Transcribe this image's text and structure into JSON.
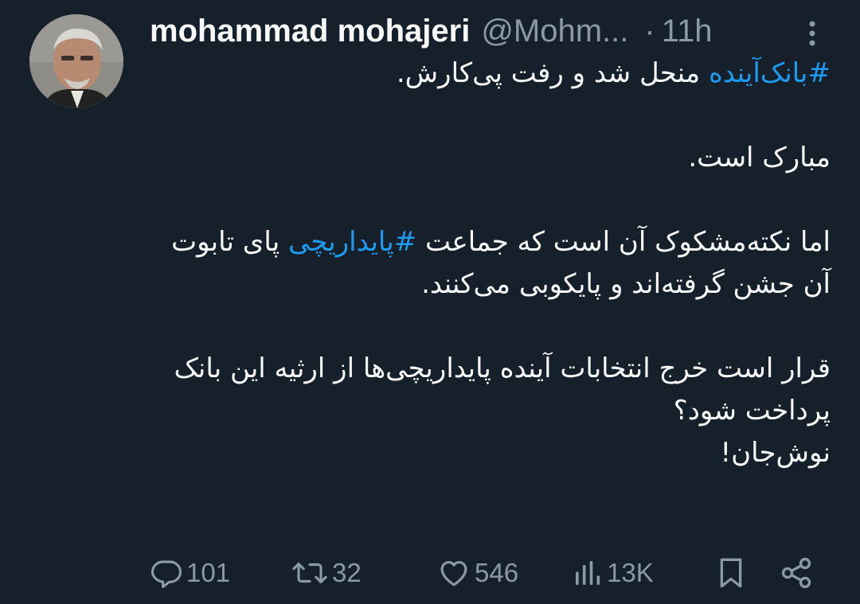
{
  "author": {
    "name": "mohammad mohajeri",
    "handle": "@Mohm...",
    "separator": "·",
    "time": "11h"
  },
  "tweet": {
    "line1_hashtag": "#بانک‌آینده",
    "line1_rest": " منحل شد و رفت پی‌کارش.",
    "line2": "مبارک است.",
    "line3_start": "اما نکته‌مشکوک آن است که جماعت ",
    "line3_hashtag": "#پایداریچی",
    "line3_end": " پای تابوت آن جشن گرفته‌اند و پایکوبی می‌کنند.",
    "line4": "قرار است خرج انتخابات آینده پایداریچی‌ها از ارثیه این بانک پرداخت شود؟",
    "line5": "نوش‌جان!"
  },
  "actions": {
    "replies": "101",
    "retweets": "32",
    "likes": "546",
    "views": "13K"
  },
  "icons": [
    "more-icon",
    "reply-icon",
    "retweet-icon",
    "like-icon",
    "views-icon",
    "bookmark-icon",
    "share-icon"
  ],
  "colors": {
    "background": "#15202b",
    "text": "#f7f9f9",
    "muted": "#8b98a5",
    "accent": "#1d9bf0"
  }
}
